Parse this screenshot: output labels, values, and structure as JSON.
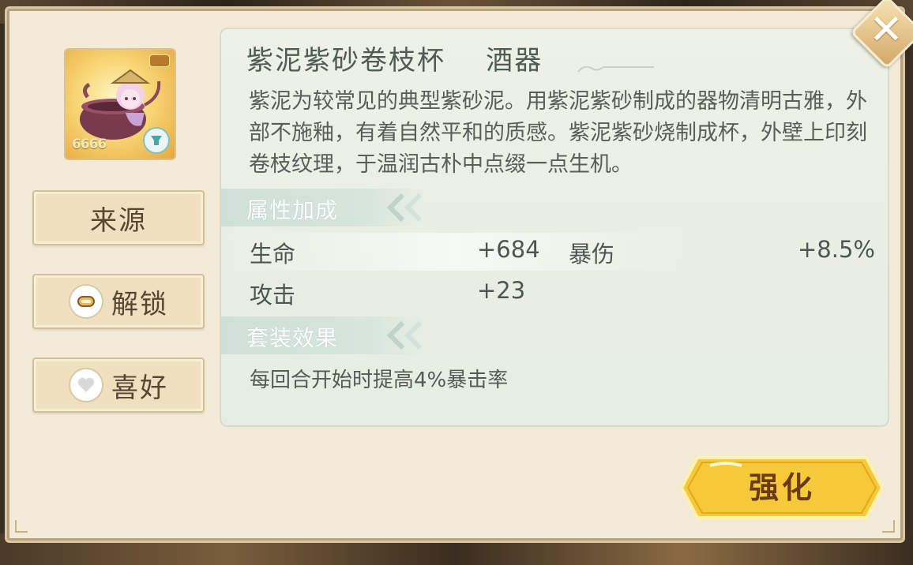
{
  "item": {
    "name": "紫泥紫砂卷枝杯",
    "category": "酒器",
    "stars": "6666",
    "description": "紫泥为较常见的典型紫砂泥。用紫泥紫砂制成的器物清明古雅，外部不施釉，有着自然平和的质感。紫泥紫砂烧制成杯，外壁上印刻卷枝纹理，于温润古朴中点缀一点生机。"
  },
  "side_buttons": {
    "source_label": "来源",
    "unlock_label": "解锁",
    "like_label": "喜好"
  },
  "attributes": {
    "section_label": "属性加成",
    "stats": [
      {
        "name": "生命",
        "value": "+684"
      },
      {
        "name": "暴伤",
        "value": "+8.5%"
      },
      {
        "name": "攻击",
        "value": "+23"
      }
    ]
  },
  "set_effect": {
    "section_label": "套装效果",
    "text": "每回合开始时提高4%暴击率"
  },
  "actions": {
    "enhance_label": "强化",
    "close_symbol": "✕"
  },
  "colors": {
    "panel_bg": "#f3ead8",
    "info_bg": "#e6ede2",
    "section_tag": "#cfe0d9",
    "enhance_gold": "#f6c93a"
  }
}
